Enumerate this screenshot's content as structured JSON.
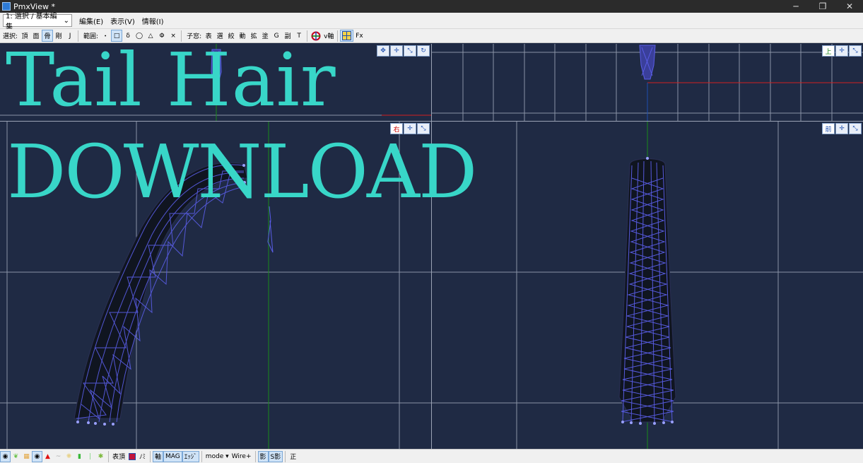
{
  "window": {
    "title": "PmxView *",
    "minimize": "─",
    "restore": "❐",
    "close": "✕"
  },
  "menubar": {
    "mode_select": "1: 選択 / 基本編集",
    "items": [
      "編集(E)",
      "表示(V)",
      "情報(I)"
    ]
  },
  "toolbar": {
    "select_label": "選択:",
    "select_buttons": [
      "頂",
      "面",
      "骨",
      "剛",
      "J"
    ],
    "range_label": "範囲:",
    "range_buttons": [
      "・",
      "□",
      "δ",
      "◯",
      "△",
      "Φ",
      "×"
    ],
    "subwin_label": "子窓:",
    "subwin_buttons": [
      "表",
      "選",
      "絞",
      "動",
      "拡",
      "塗",
      "G",
      "副",
      "T"
    ],
    "axis_label": "v軸",
    "fx_label": "Fx"
  },
  "viewports": {
    "top_right_label": "上",
    "bottom_left_label": "右",
    "bottom_right_label": "前"
  },
  "overlay": {
    "line1": "Tail Hair",
    "line2": "DOWNLOAD"
  },
  "statusbar": {
    "table_label": "表頂",
    "no_label": "ﾉﾐ",
    "axis_btn": "軸",
    "mag_btn": "MAG",
    "edge_btn": "ｴｯｼﾞ",
    "mode_label": "mode ▾",
    "wire_label": "Wire+",
    "shadow_label": "影",
    "sshadow_label": "S影",
    "ortho_label": "正"
  },
  "colors": {
    "overlay_text": "#38d6c8",
    "viewport_bg": "#1f2a44",
    "mesh": "#5a5ee8",
    "grid": "#8a93a6"
  }
}
